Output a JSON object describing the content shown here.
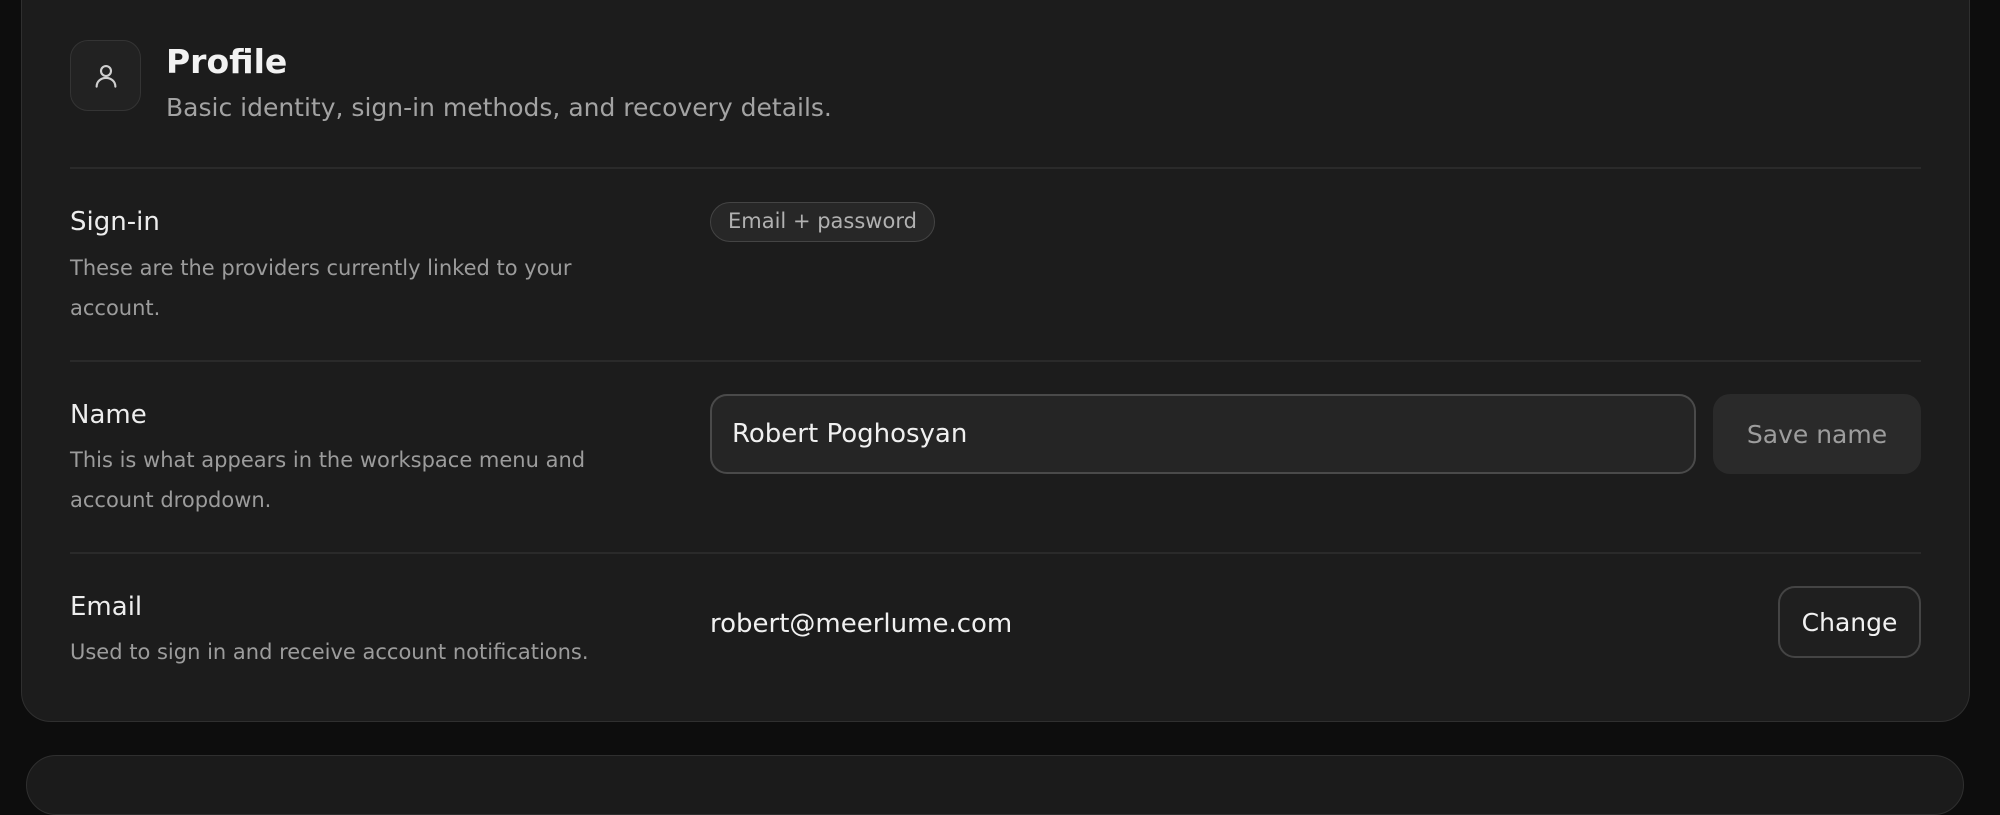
{
  "profile": {
    "title": "Profile",
    "subtitle": "Basic identity, sign-in methods, and recovery details.",
    "icon": "user-icon"
  },
  "signin": {
    "title": "Sign-in",
    "description": "These are the providers currently linked to your account.",
    "providers": [
      "Email + password"
    ]
  },
  "name_row": {
    "title": "Name",
    "description": "This is what appears in the workspace menu and account dropdown.",
    "value": "Robert Poghosyan",
    "save_label": "Save name"
  },
  "email_row": {
    "title": "Email",
    "description": "Used to sign in and receive account notifications.",
    "value": "robert@meerlume.com",
    "change_label": "Change"
  }
}
